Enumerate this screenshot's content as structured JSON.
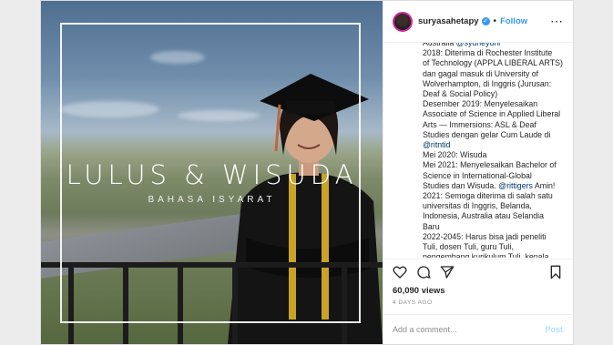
{
  "post": {
    "image": {
      "title": "LULUS & WISUDA",
      "subtitle": "BAHASA ISYARAT"
    },
    "header": {
      "username": "suryasahetapy",
      "follow_label": "Follow",
      "separator": "•"
    },
    "caption_lines": [
      "Australia @sydneyuni",
      "2018: Diterima di Rochester Institute",
      "of Technology (APPLA LIBERAL ARTS)",
      "dan gagal masuk di University of",
      "Wolverhampton, di Inggris (Jurusan:",
      "Deaf & Social Policy)",
      "Desember 2019: Menyelesaikan",
      "Associate of Science in Applied Liberal",
      "Arts — Immersions: ASL & Deaf",
      "Studies dengan gelar Cum Laude di",
      "@ritntid",
      "Mei 2020: Wisuda",
      "Mei 2021: Menyelesaikan Bachelor of",
      "Science in International-Global",
      "Studies dan Wisuda. @rittigers Amin!",
      "2021: Semoga diterima di salah satu",
      "universitas di Inggris, Belanda,",
      "Indonesia, Australia atau Selandia",
      "Baru",
      "2022-2045: Harus bisa jadi peneliti",
      "Tuli, dosen Tuli, guru Tuli,",
      "pengembang kurikulum Tuli, kepala"
    ],
    "views": "60,090 views",
    "age": "4 DAYS AGO",
    "comment_placeholder": "Add a comment...",
    "post_label": "Post"
  },
  "colors": {
    "follow": "#3897f0",
    "post_disabled": "#b2dffc",
    "mention": "#00376b"
  }
}
